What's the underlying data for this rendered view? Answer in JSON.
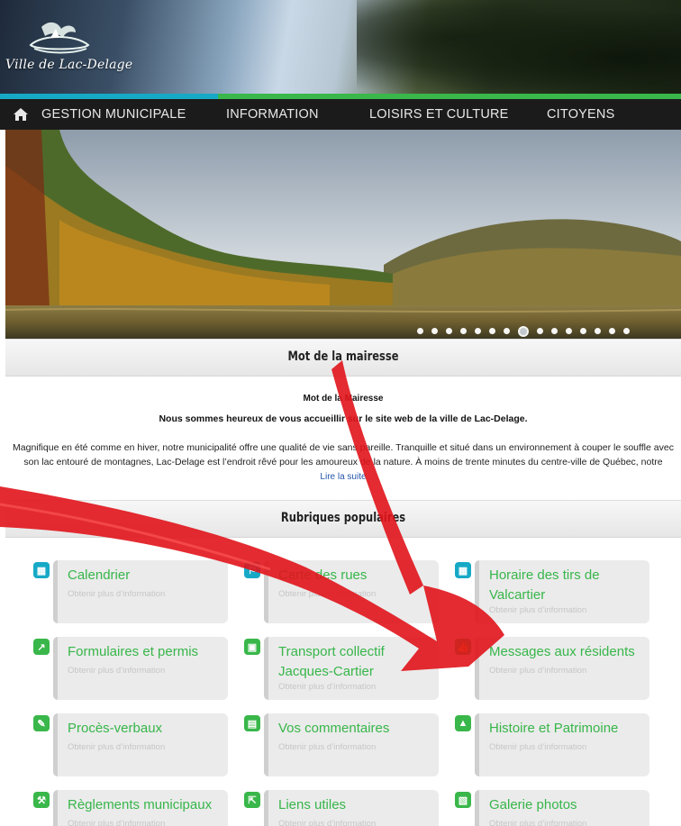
{
  "header": {
    "site_name": "Ville de Lac-Delage",
    "colors": {
      "stripe_blue": "#16a9c6",
      "stripe_green": "#39b74a",
      "nav_bg": "#1b1b1b"
    }
  },
  "nav": {
    "home_icon": "home-icon",
    "items": [
      "GESTION MUNICIPALE",
      "INFORMATION",
      "LOISIRS ET CULTURE",
      "CITOYENS"
    ]
  },
  "slider": {
    "dot_count": 15,
    "active_index": 7
  },
  "mot": {
    "title": "Mot de la mairesse",
    "intro": "Mot de la Mairesse",
    "subtitle": "Nous sommes heureux de vous accueillir sur le site web de la ville de Lac-Delage.",
    "paragraph": "Magnifique en été comme en hiver, notre municipalité offre une qualité de vie sans pareille. Tranquille et situé dans un environnement à couper le souffle avec son lac entouré de montagnes, Lac-Delage est l’endroit rêvé pour les amoureux de la nature. À moins de trente minutes du centre-ville de Québec, notre",
    "read_more": "Lire la suite"
  },
  "rubriques": {
    "title": "Rubriques populaires",
    "subtitle_text": "Obtenir plus d’information",
    "cards": [
      {
        "title": "Calendrier",
        "icon": "calendar-icon",
        "color": "#16a9c6"
      },
      {
        "title": "Carte des rues",
        "icon": "map-icon",
        "color": "#16a9c6"
      },
      {
        "title": "Horaire des tirs de Valcartier",
        "icon": "calendar-icon",
        "color": "#16a9c6"
      },
      {
        "title": "Formulaires et permis",
        "icon": "hammer-icon",
        "color": "#39b74a"
      },
      {
        "title": "Transport collectif Jacques-Cartier",
        "icon": "bus-icon",
        "color": "#39b74a"
      },
      {
        "title": "Messages aux résidents",
        "icon": "thumbs-up-icon",
        "color": "#39b74a"
      },
      {
        "title": "Procès-verbaux",
        "icon": "edit-icon",
        "color": "#39b74a"
      },
      {
        "title": "Vos commentaires",
        "icon": "document-icon",
        "color": "#39b74a"
      },
      {
        "title": "Histoire et Patrimoine",
        "icon": "building-icon",
        "color": "#39b74a"
      },
      {
        "title": "Règlements municipaux",
        "icon": "gavel-icon",
        "color": "#39b74a"
      },
      {
        "title": "Liens utiles",
        "icon": "external-link-icon",
        "color": "#39b74a"
      },
      {
        "title": "Galerie photos",
        "icon": "photo-icon",
        "color": "#39b74a"
      }
    ]
  },
  "overlay": {
    "arrow_color": "#e0141b"
  }
}
